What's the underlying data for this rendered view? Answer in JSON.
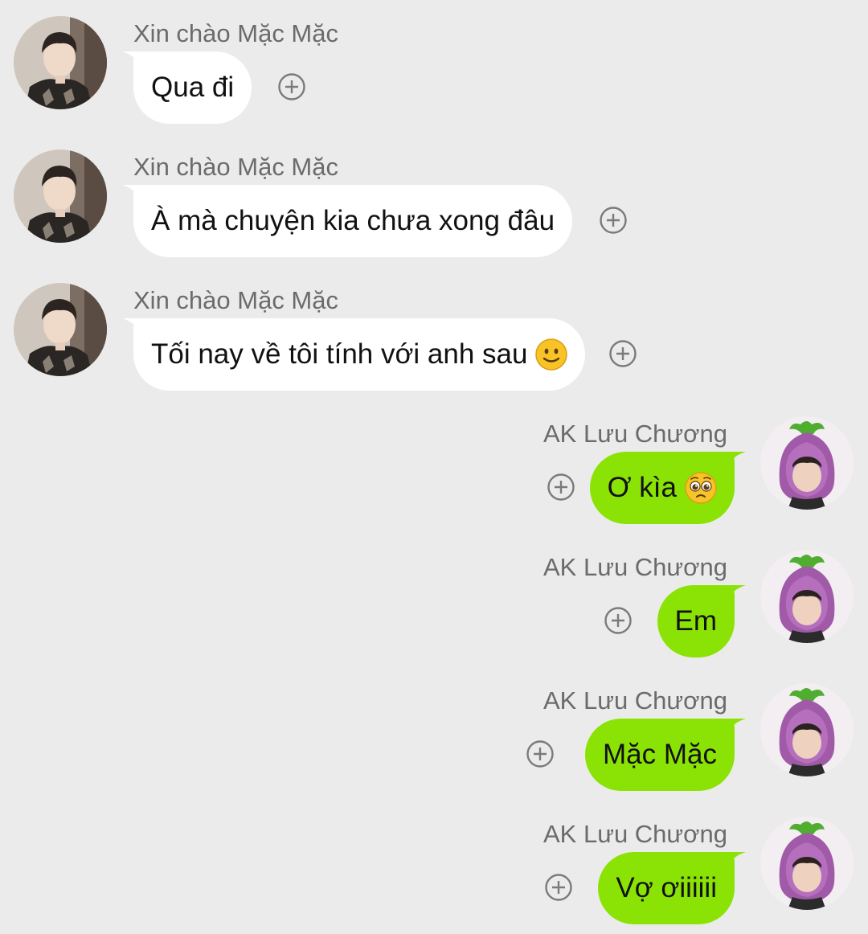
{
  "conversation": {
    "messages": [
      {
        "sender": "Xin chào Mặc Mặc",
        "text": "Qua đi",
        "side": "left",
        "emoji": null
      },
      {
        "sender": "Xin chào Mặc Mặc",
        "text": "À mà chuyện kia chưa xong đâu",
        "side": "left",
        "emoji": null
      },
      {
        "sender": "Xin chào Mặc Mặc",
        "text": "Tối nay về tôi tính với anh sau",
        "side": "left",
        "emoji": "slightly-smiling-face-icon"
      },
      {
        "sender": "AK Lưu Chương",
        "text": "Ơ kìa",
        "side": "right",
        "emoji": "pleading-face-icon"
      },
      {
        "sender": "AK Lưu Chương",
        "text": "Em",
        "side": "right",
        "emoji": null
      },
      {
        "sender": "AK Lưu Chương",
        "text": "Mặc Mặc",
        "side": "right",
        "emoji": null
      },
      {
        "sender": "AK Lưu Chương",
        "text": "Vợ ơiiiiii",
        "side": "right",
        "emoji": null
      }
    ]
  },
  "colors": {
    "background": "#ebebeb",
    "incoming_bubble": "#ffffff",
    "outgoing_bubble": "#8be305",
    "sender_name": "#6b6b6b",
    "plus_icon": "#7a7a7a"
  }
}
